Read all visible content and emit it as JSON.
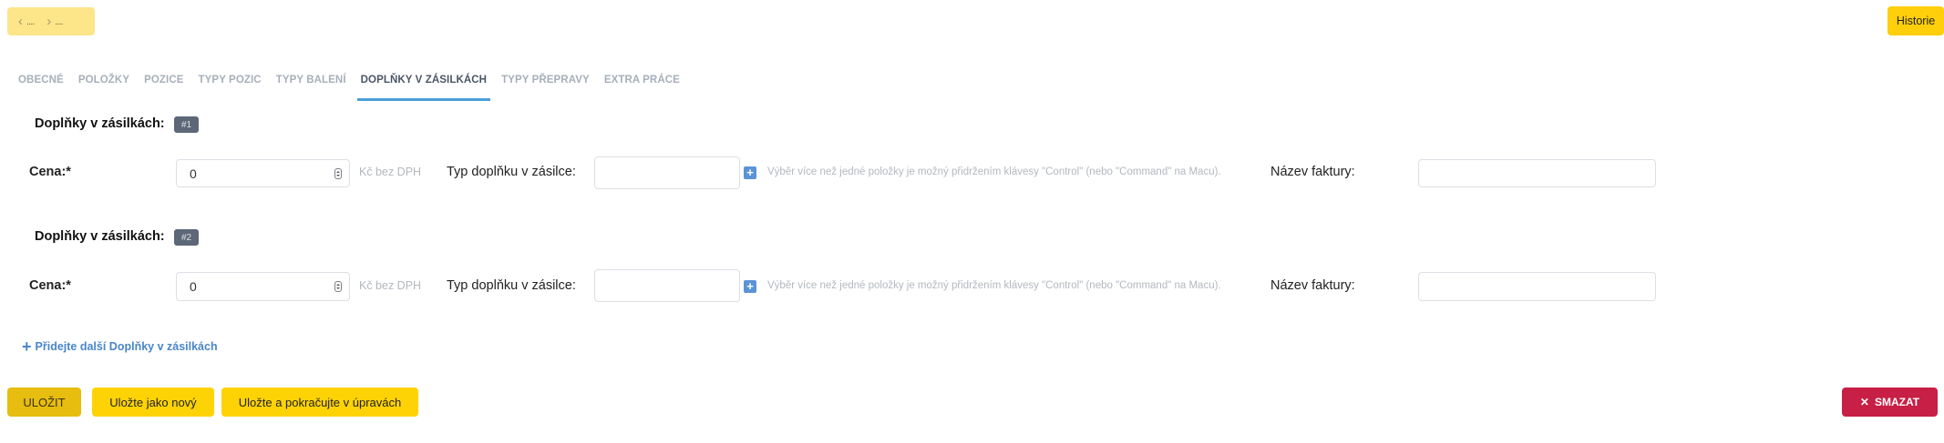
{
  "nav": {
    "prev_label": "....",
    "next_label": "....",
    "prev_icon": "chevron-left-icon",
    "next_icon": "chevron-right-icon"
  },
  "header": {
    "history_label": "Historie"
  },
  "tabs": [
    {
      "label": "OBECNÉ"
    },
    {
      "label": "POLOŽKY"
    },
    {
      "label": "POZICE"
    },
    {
      "label": "TYPY POZIC"
    },
    {
      "label": "TYPY BALENÍ"
    },
    {
      "label": "DOPLŇKY V ZÁSILKÁCH",
      "active": true
    },
    {
      "label": "TYPY PŘEPRAVY"
    },
    {
      "label": "EXTRA PRÁCE"
    }
  ],
  "sections": [
    {
      "title": "Doplňky v zásilkách:",
      "badge": "#1",
      "price_label": "Cena:*",
      "price_value": "0",
      "price_unit": "Kč bez DPH",
      "type_label": "Typ doplňku v zásilce:",
      "type_hint": "Výběr více než jedné položky je možný přidržením klávesy \"Control\" (nebo \"Command\" na Macu).",
      "invoice_label": "Název faktury:",
      "invoice_value": ""
    },
    {
      "title": "Doplňky v zásilkách:",
      "badge": "#2",
      "price_label": "Cena:*",
      "price_value": "0",
      "price_unit": "Kč bez DPH",
      "type_label": "Typ doplňku v zásilce:",
      "type_hint": "Výběr více než jedné položky je možný přidržením klávesy \"Control\" (nebo \"Command\" na Macu).",
      "invoice_label": "Název faktury:",
      "invoice_value": ""
    }
  ],
  "add_link": {
    "label": "Přidejte další Doplňky v zásilkách"
  },
  "footer": {
    "save_label": "ULOŽIT",
    "save_new_label": "Uložte jako nový",
    "save_continue_label": "Uložte a pokračujte v úpravách",
    "delete_label": "SMAZAT"
  },
  "colors": {
    "primary_yellow": "#fed306",
    "danger": "#c71f45",
    "tab_active_underline": "#4a9fd8",
    "link_blue": "#4a86c8"
  }
}
